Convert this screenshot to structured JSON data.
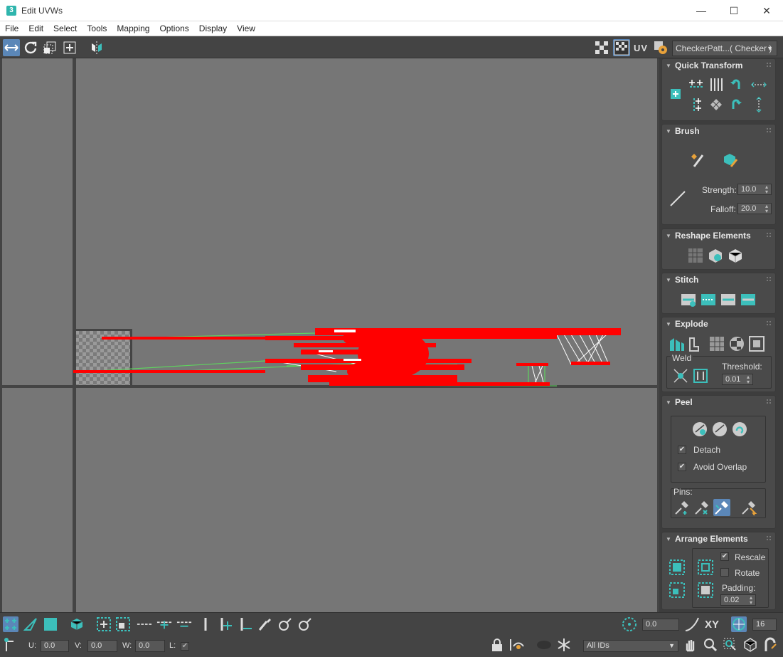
{
  "window": {
    "title": "Edit UVWs",
    "app_icon": "3"
  },
  "menu": [
    "File",
    "Edit",
    "Select",
    "Tools",
    "Mapping",
    "Options",
    "Display",
    "View"
  ],
  "toolbar": {
    "uv_label": "UV",
    "texture_dropdown": "CheckerPatt...( Checker )"
  },
  "panel": {
    "quick_transform": {
      "title": "Quick Transform"
    },
    "brush": {
      "title": "Brush",
      "strength_label": "Strength:",
      "strength": "10.0",
      "falloff_label": "Falloff:",
      "falloff": "20.0"
    },
    "reshape": {
      "title": "Reshape Elements"
    },
    "stitch": {
      "title": "Stitch"
    },
    "explode": {
      "title": "Explode",
      "weld_label": "Weld",
      "threshold_label": "Threshold:",
      "threshold": "0.01"
    },
    "peel": {
      "title": "Peel",
      "detach_label": "Detach",
      "avoid_overlap_label": "Avoid Overlap",
      "pins_label": "Pins:"
    },
    "arrange": {
      "title": "Arrange Elements",
      "rescale_label": "Rescale",
      "rotate_label": "Rotate",
      "padding_label": "Padding:",
      "padding": "0.02"
    }
  },
  "bottom": {
    "angle_value": "0.0",
    "xy_label": "XY",
    "grid_value": "16",
    "u_label": "U:",
    "u_value": "0.0",
    "v_label": "V:",
    "v_value": "0.0",
    "w_label": "W:",
    "w_value": "0.0",
    "l_label": "L:",
    "ids_dropdown": "All IDs"
  },
  "colors": {
    "accent": "#3cbfbb",
    "selection": "#ff0000",
    "viewport_bg": "#767676",
    "active_btn": "#5b87b8"
  }
}
